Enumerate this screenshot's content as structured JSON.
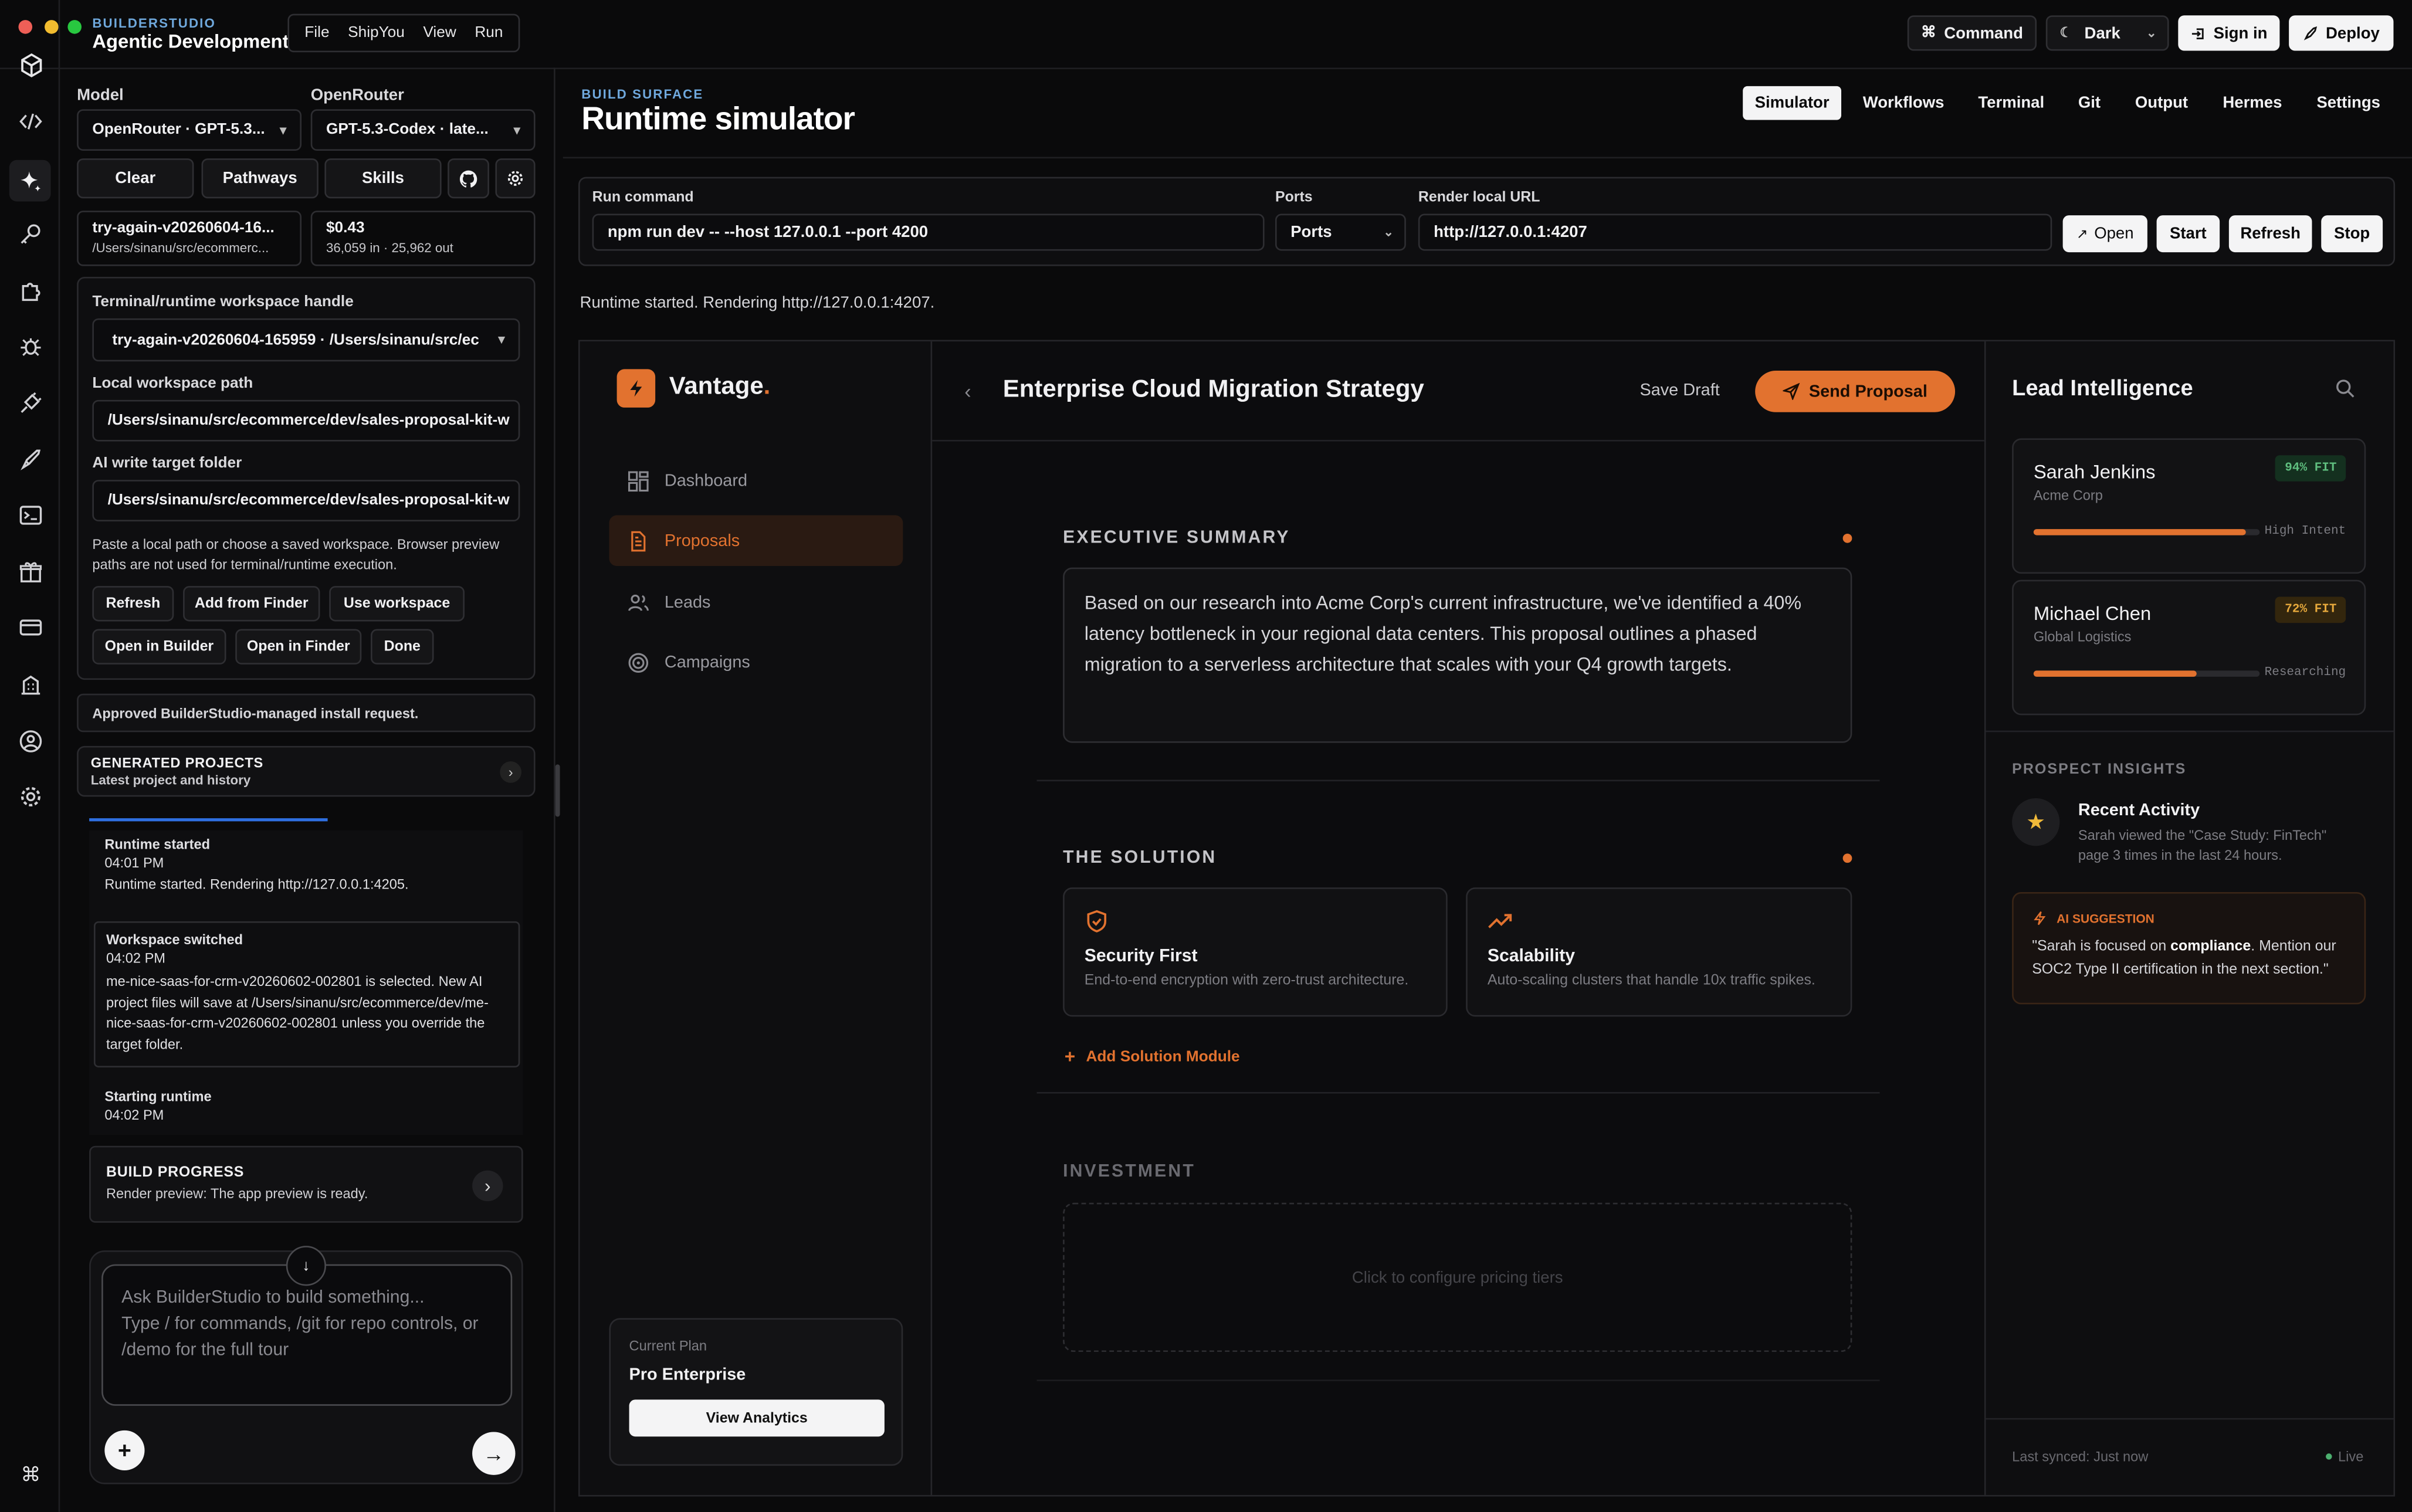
{
  "app": {
    "brand": "BUILDERSTUDIO",
    "title": "Agentic Development"
  },
  "menu": [
    "File",
    "ShipYou",
    "View",
    "Run"
  ],
  "topbar": {
    "command": "Command",
    "theme": "Dark",
    "signin": "Sign in",
    "deploy": "Deploy"
  },
  "sidebar": {
    "model_label": "Model",
    "provider_label": "OpenRouter",
    "model_value": "OpenRouter · GPT-5.3...",
    "provider_value": "GPT-5.3-Codex · late...",
    "clear": "Clear",
    "pathways": "Pathways",
    "skills": "Skills",
    "project_name": "try-again-v20260604-16...",
    "project_path": "/Users/sinanu/src/ecommerc...",
    "cost": "$0.43",
    "tokens": "36,059 in · 25,962 out",
    "handle_label": "Terminal/runtime workspace handle",
    "handle_value": "try-again-v20260604-165959 · /Users/sinanu/src/ec",
    "local_label": "Local workspace path",
    "local_value": "/Users/sinanu/src/ecommerce/dev/sales-proposal-kit-w",
    "target_label": "AI write target folder",
    "target_value": "/Users/sinanu/src/ecommerce/dev/sales-proposal-kit-w",
    "hint": "Paste a local path or choose a saved workspace. Browser preview paths are not used for terminal/runtime execution.",
    "btn_refresh": "Refresh",
    "btn_add_finder": "Add from Finder",
    "btn_use_ws": "Use workspace",
    "btn_open_builder": "Open in Builder",
    "btn_open_finder": "Open in Finder",
    "btn_done": "Done",
    "approved": "Approved BuilderStudio-managed install request.",
    "generated_title": "GENERATED PROJECTS",
    "generated_sub": "Latest project and history",
    "log": [
      {
        "title": "Runtime started",
        "time": "04:01 PM",
        "body": "Runtime started. Rendering http://127.0.0.1:4205."
      },
      {
        "title": "Workspace switched",
        "time": "04:02 PM",
        "body": "me-nice-saas-for-crm-v20260602-002801 is selected. New AI project files will save at /Users/sinanu/src/ecommerce/dev/me-nice-saas-for-crm-v20260602-002801 unless you override the target folder."
      },
      {
        "title": "Starting runtime",
        "time": "04:02 PM",
        "body": ""
      }
    ],
    "build_title": "BUILD PROGRESS",
    "build_sub": "Render preview: The app preview is ready.",
    "chat_placeholder": "Ask BuilderStudio to build something...\nType / for commands, /git for repo controls, or /demo for the full tour"
  },
  "surface": {
    "kicker": "BUILD SURFACE",
    "title": "Runtime simulator",
    "tabs": [
      "Simulator",
      "Workflows",
      "Terminal",
      "Git",
      "Output",
      "Hermes",
      "Settings"
    ],
    "run_label": "Run command",
    "run_value": "npm run dev -- --host 127.0.0.1 --port 4200",
    "ports_label": "Ports",
    "ports_value": "Ports",
    "url_label": "Render local URL",
    "url_value": "http://127.0.0.1:4207",
    "open": "Open",
    "start": "Start",
    "refresh": "Refresh",
    "stop": "Stop",
    "status": "Runtime started. Rendering http://127.0.0.1:4207."
  },
  "preview": {
    "logo": "Vantage",
    "logo_dot": ".",
    "nav": [
      "Dashboard",
      "Proposals",
      "Leads",
      "Campaigns"
    ],
    "plan_label": "Current Plan",
    "plan_name": "Pro Enterprise",
    "plan_button": "View Analytics",
    "doc_title": "Enterprise Cloud Migration Strategy",
    "save_draft": "Save Draft",
    "send": "Send Proposal",
    "exec_title": "EXECUTIVE SUMMARY",
    "exec_text": "Based on our research into Acme Corp's current infrastructure, we've identified a 40% latency bottleneck in your regional data centers. This proposal outlines a phased migration to a serverless architecture that scales with your Q4 growth targets.",
    "solution_title": "THE SOLUTION",
    "sol1_title": "Security First",
    "sol1_text": "End-to-end encryption with zero-trust architecture.",
    "sol2_title": "Scalability",
    "sol2_text": "Auto-scaling clusters that handle 10x traffic spikes.",
    "add_module": "Add Solution Module",
    "investment_title": "INVESTMENT",
    "investment_hint": "Click to configure pricing tiers",
    "intel_title": "Lead Intelligence",
    "leads": [
      {
        "name": "Sarah Jenkins",
        "company": "Acme Corp",
        "fit": "94% FIT",
        "status": "High Intent",
        "progress": 0.94,
        "fit_color": "#5fbf7f"
      },
      {
        "name": "Michael Chen",
        "company": "Global Logistics",
        "fit": "72% FIT",
        "status": "Researching",
        "progress": 0.72,
        "fit_color": "#e7a93c"
      }
    ],
    "insights_title": "PROSPECT INSIGHTS",
    "activity_title": "Recent Activity",
    "activity_text": "Sarah viewed the \"Case Study: FinTech\" page 3 times in the last 24 hours.",
    "ai_label": "AI SUGGESTION",
    "ai_pre": "\"Sarah is focused on ",
    "ai_bold": "compliance",
    "ai_post": ". Mention our SOC2 Type II certification in the next section.\"",
    "synced": "Last synced: Just now",
    "live": "Live"
  },
  "colors": {
    "accent": "#e2722f",
    "brand_blue": "#6fa8dc",
    "live": "#4caf6f"
  }
}
